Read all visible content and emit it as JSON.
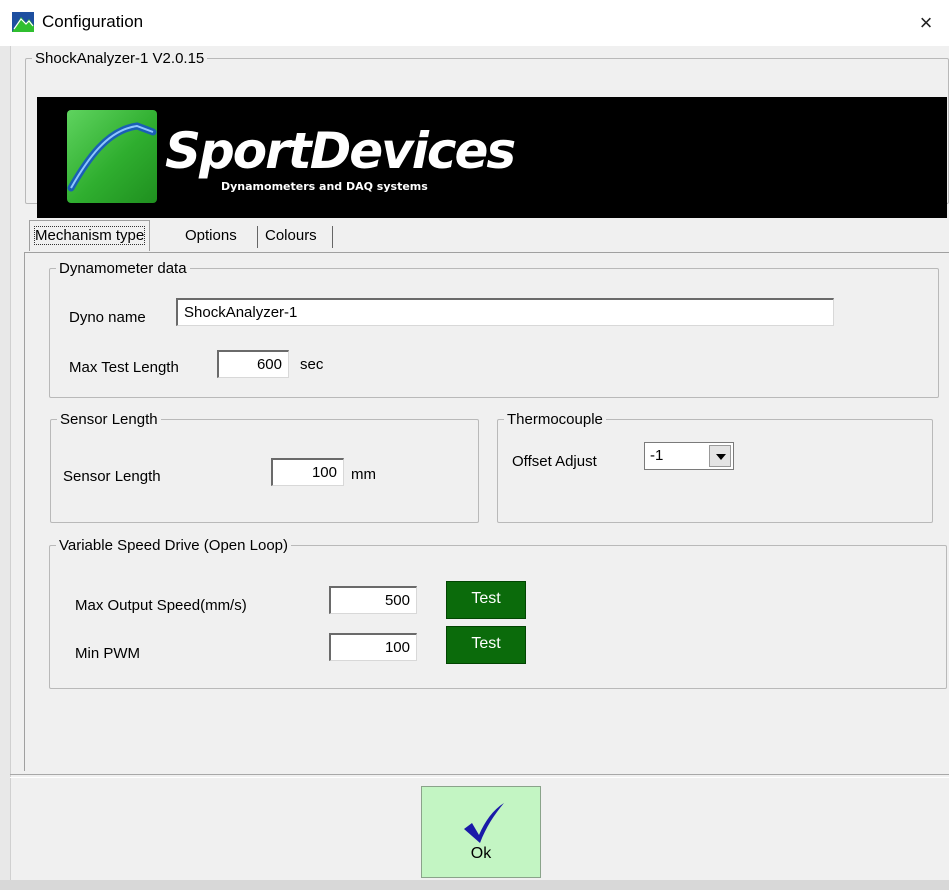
{
  "window": {
    "title": "Configuration",
    "close_glyph": "×"
  },
  "header_group": {
    "legend": "ShockAnalyzer-1 V2.0.15",
    "logo_text": "SportDevices",
    "logo_subtext": "Dynamometers and DAQ systems"
  },
  "tabs": [
    {
      "label": "Mechanism type",
      "active": true
    },
    {
      "label": "Options",
      "active": false
    },
    {
      "label": "Colours",
      "active": false
    }
  ],
  "dyno": {
    "legend": "Dynamometer data",
    "name_label": "Dyno name",
    "name_value": "ShockAnalyzer-1",
    "max_test_label": "Max Test Length",
    "max_test_value": "600",
    "max_test_unit": "sec"
  },
  "sensor": {
    "legend": "Sensor Length",
    "label": "Sensor Length",
    "value": "100",
    "unit": "mm"
  },
  "thermo": {
    "legend": "Thermocouple",
    "offset_label": "Offset Adjust",
    "offset_value": "-1"
  },
  "vsd": {
    "legend": "Variable Speed Drive (Open Loop)",
    "max_speed_label": "Max Output Speed(mm/s)",
    "max_speed_value": "500",
    "min_pwm_label": "Min PWM",
    "min_pwm_value": "100",
    "test_label": "Test"
  },
  "ok_button": {
    "label": "Ok"
  },
  "colors": {
    "test_button": "#0b6b0b",
    "ok_button": "#c3f5c3",
    "checkmark": "#1a1aa8",
    "logo_green": "#3fbf3f"
  },
  "icons": {
    "app": "app-mountain-icon",
    "close": "close-icon",
    "dropdown": "chevron-down-icon",
    "ok": "checkmark-icon"
  }
}
